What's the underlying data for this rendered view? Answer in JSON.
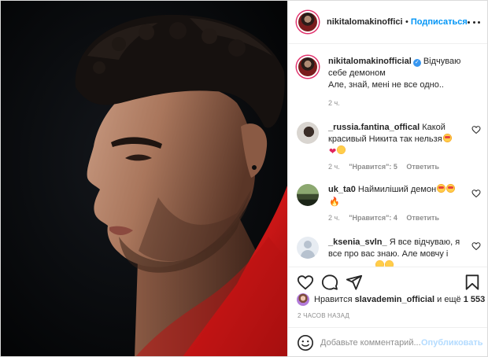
{
  "header": {
    "username": "nikitalomakinofficial",
    "separator": "•",
    "follow_label": "Подписаться"
  },
  "caption": {
    "username": "nikitalomakinofficial",
    "verified_mark": "✓",
    "text": "Відчуваю себе демоном Але, знай, мені не все одно..",
    "text_line1": "Відчуваю",
    "text_line2": "себе демоном",
    "text_line3": "Але, знай, мені не все одно..",
    "time": "2 ч."
  },
  "comments": [
    {
      "username": "_russia.fantina_offical",
      "text": "Какой красивый Никита так нельзя",
      "text_line1": "Какой",
      "text_line2": "красивый Никита так нельзя",
      "emojis": [
        "star-eyes-emoji",
        "red-heart-emoji",
        "laughing-emoji"
      ],
      "time": "2 ч.",
      "likes": "\"Нравится\": 5",
      "reply_label": "Ответить"
    },
    {
      "username": "uk_ta0",
      "text": "Наймиліший демон",
      "emojis": [
        "star-eyes-emoji",
        "star-eyes-emoji",
        "fire-emoji"
      ],
      "time": "2 ч.",
      "likes": "\"Нравится\": 4",
      "reply_label": "Ответить"
    },
    {
      "username": "_ksenia_svln_",
      "text_line1": "Я все відчуваю, я",
      "text_line2": "все про вас знаю. Але мовчу і",
      "text": "Я все відчуваю, я все про вас знаю. Але мовчу і"
    }
  ],
  "likes": {
    "prefix": "Нравится",
    "user": "slavademin_official",
    "middle": "и ещё",
    "count": "1 553"
  },
  "timestamp": "2 ЧАСОВ НАЗАД",
  "add_comment": {
    "placeholder": "Добавьте комментарий...",
    "post_label": "Опубликовать"
  },
  "colors": {
    "accent": "#0095f6",
    "muted": "#8e8e8e",
    "text": "#262626",
    "jacket_red": "#d11a1a"
  },
  "icons": [
    "heart-icon",
    "comment-icon",
    "share-icon",
    "bookmark-icon",
    "smile-icon",
    "more-options-icon",
    "verified-badge-icon"
  ]
}
